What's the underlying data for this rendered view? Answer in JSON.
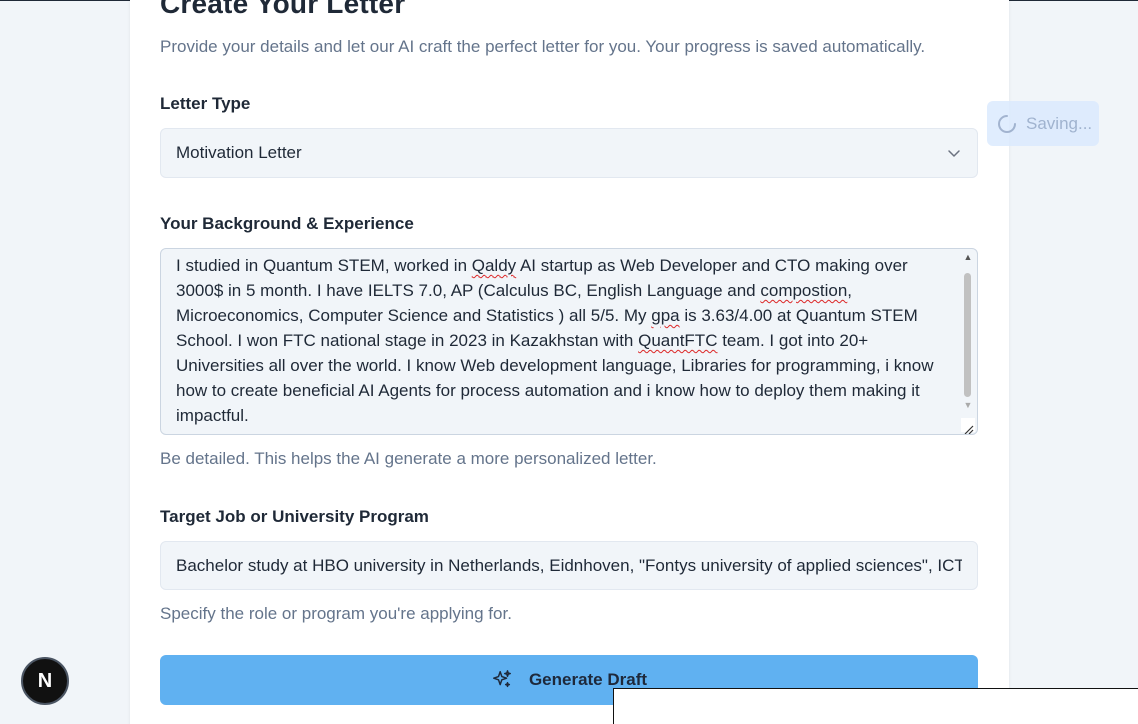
{
  "page": {
    "title": "Create Your Letter",
    "subtitle": "Provide your details and let our AI craft the perfect letter for you. Your progress is saved automatically."
  },
  "letter_type": {
    "label": "Letter Type",
    "value": "Motivation Letter",
    "icon": "chevron-down-icon"
  },
  "background": {
    "label": "Your Background & Experience",
    "value": "I studied in Quantum STEM, worked in Qaldy AI startup as Web Developer and CTO making over 3000$ in 5 month. I have IELTS 7.0, AP (Calculus BC, English Language and compostion, Microeconomics, Computer Science and Statistics ) all 5/5. My gpa is 3.63/4.00 at Quantum STEM School. I won FTC national stage in 2023 in Kazakhstan with QuantFTC team. I got into 20+ Universities all over the world. I know Web development language, Libraries for programming, i know how to create beneficial AI Agents for process automation and i know how to deploy them making it impactful.",
    "helper": "Be detailed. This helps the AI generate a more personalized letter.",
    "misspelled": [
      "Qaldy",
      "compostion",
      "gpa",
      "QuantFTC"
    ]
  },
  "target": {
    "label": "Target Job or University Program",
    "value": "Bachelor study at HBO university in Netherlands, Eidnhoven, \"Fontys university of applied sciences\", ICT",
    "helper": "Specify the role or program you're applying for."
  },
  "generate": {
    "label": "Generate Draft",
    "icon": "sparkles-icon"
  },
  "status": {
    "saving_label": "Saving...",
    "icon": "spinner-icon"
  },
  "badge": {
    "letter": "N"
  },
  "colors": {
    "primary_button": "#60b1f1",
    "field_bg": "#f1f5f9",
    "muted_text": "#64748b",
    "spellcheck": "#dc2626"
  }
}
